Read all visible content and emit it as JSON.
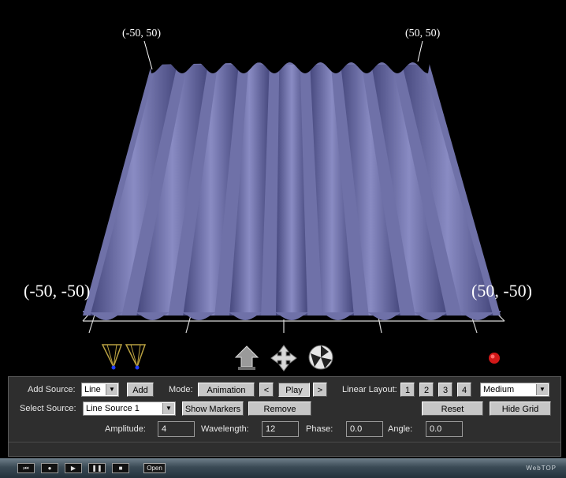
{
  "scene": {
    "corners": {
      "top_left": "(-50, 50)",
      "top_right": "(50, 50)",
      "bottom_left": "(-50, -50)",
      "bottom_right": "(50, -50)"
    },
    "surface_color": "#6f71a8",
    "crests": 9
  },
  "controls": {
    "add_source_label": "Add Source:",
    "source_type": "Line",
    "add_button": "Add",
    "mode_label": "Mode:",
    "mode_value": "Animation",
    "prev_button": "<",
    "play_button": "Play",
    "next_button": ">",
    "linear_layout_label": "Linear Layout:",
    "layout_buttons": [
      "1",
      "2",
      "3",
      "4"
    ],
    "quality": "Medium",
    "select_source_label": "Select Source:",
    "selected_source": "Line Source 1",
    "show_markers_button": "Show Markers",
    "remove_button": "Remove",
    "reset_button": "Reset",
    "hide_grid_button": "Hide Grid",
    "amplitude_label": "Amplitude:",
    "amplitude_value": "4",
    "wavelength_label": "Wavelength:",
    "wavelength_value": "12",
    "phase_label": "Phase:",
    "phase_value": "0.0",
    "angle_label": "Angle:",
    "angle_value": "0.0"
  },
  "taskbar": {
    "open_button": "Open",
    "brand": "WebTOP"
  }
}
